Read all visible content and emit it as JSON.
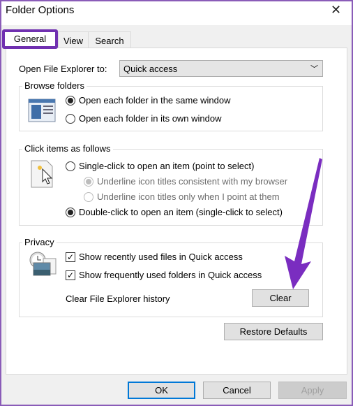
{
  "window": {
    "title": "Folder Options",
    "close_icon": "close-icon"
  },
  "tabs": [
    {
      "label": "General",
      "selected": true
    },
    {
      "label": "View"
    },
    {
      "label": "Search"
    }
  ],
  "open_to": {
    "label": "Open File Explorer to:",
    "value": "Quick access"
  },
  "browse": {
    "legend": "Browse folders",
    "options": [
      {
        "label": "Open each folder in the same window",
        "checked": true
      },
      {
        "label": "Open each folder in its own window",
        "checked": false
      }
    ]
  },
  "click": {
    "legend": "Click items as follows",
    "single": "Single-click to open an item (point to select)",
    "sub1": "Underline icon titles consistent with my browser",
    "sub2": "Underline icon titles only when I point at them",
    "double": "Double-click to open an item (single-click to select)"
  },
  "privacy": {
    "legend": "Privacy",
    "recent": "Show recently used files in Quick access",
    "frequent": "Show frequently used folders in Quick access",
    "history": "Clear File Explorer history",
    "clear": "Clear"
  },
  "restore": "Restore Defaults",
  "footer": {
    "ok": "OK",
    "cancel": "Cancel",
    "apply": "Apply"
  },
  "colors": {
    "highlight": "#7030b0",
    "accent": "#0078d7"
  }
}
